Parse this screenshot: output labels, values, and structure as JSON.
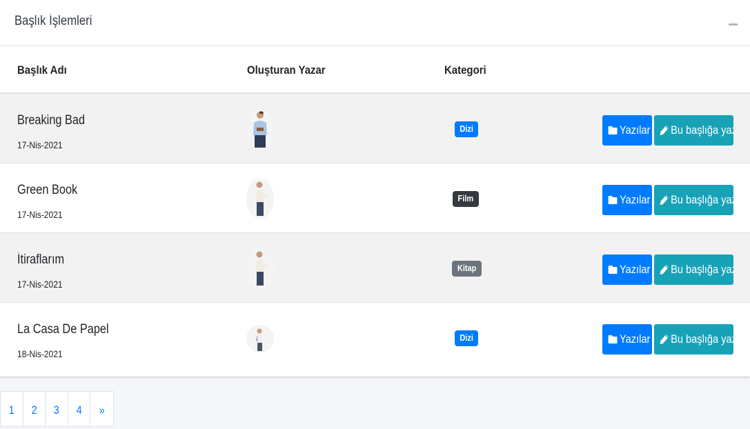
{
  "card": {
    "title": "Başlık İşlemleri",
    "collapse_icon": "minus-icon"
  },
  "table": {
    "headers": [
      "Başlık Adı",
      "Oluşturan Yazar",
      "Kategori"
    ],
    "rows": [
      {
        "title": "Breaking Bad",
        "date": "17-Nis-2021",
        "category": "Dizi",
        "category_color": "#007bff",
        "author_avatar": "man-in-suit-avatar"
      },
      {
        "title": "Green Book",
        "date": "17-Nis-2021",
        "category": "Film",
        "category_color": "#343a40",
        "author_avatar": "man-pointing-avatar"
      },
      {
        "title": "İtiraflarım",
        "date": "17-Nis-2021",
        "category": "Kitap",
        "category_color": "#6c757d",
        "author_avatar": "man-pointing-avatar"
      },
      {
        "title": "La Casa De Papel",
        "date": "18-Nis-2021",
        "category": "Dizi",
        "category_color": "#007bff",
        "author_avatar": "man-standing-avatar"
      }
    ]
  },
  "actions": {
    "posts_label": "Yazılar",
    "posts_icon": "folder-icon",
    "write_label": "Bu başlığa yaz",
    "write_icon": "pencil-icon"
  },
  "pagination": {
    "pages": [
      "1",
      "2",
      "3",
      "4"
    ],
    "next": "»"
  },
  "colors": {
    "primary": "#007bff",
    "info": "#17a2b8",
    "dark": "#343a40",
    "secondary": "#6c757d",
    "striped_row": "#f2f2f2",
    "page_bg": "#f4f6f9"
  }
}
